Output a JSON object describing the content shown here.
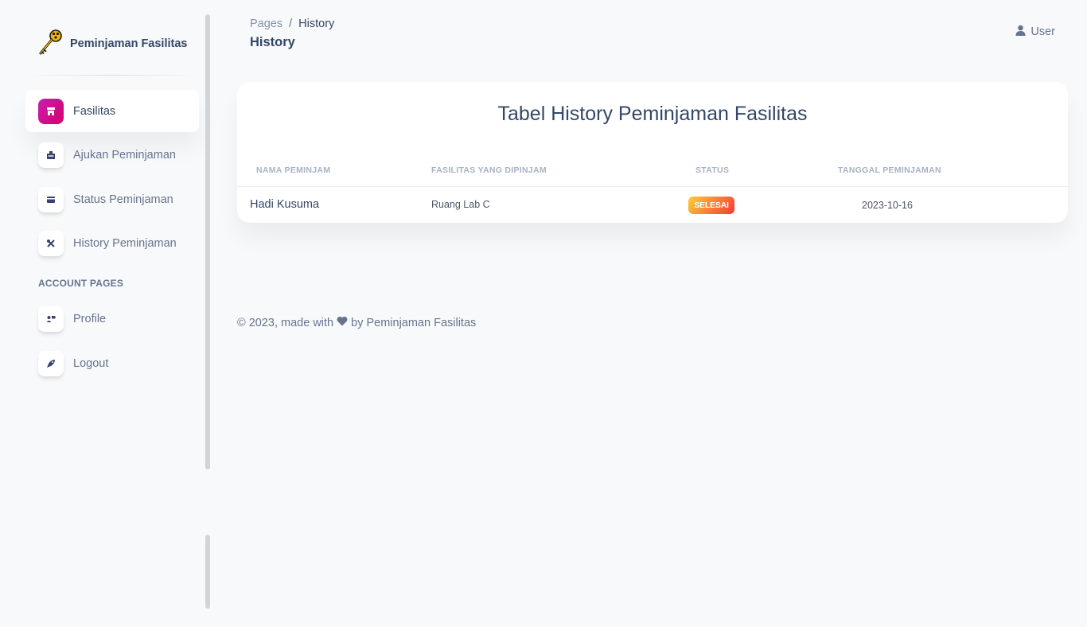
{
  "brand": {
    "name": "Peminjaman Fasilitas",
    "icon": "key-icon"
  },
  "sidebar": {
    "items": [
      {
        "label": "Fasilitas",
        "icon": "shop-icon",
        "active": true
      },
      {
        "label": "Ajukan Peminjaman",
        "icon": "office-building-icon",
        "active": false
      },
      {
        "label": "Status Peminjaman",
        "icon": "credit-card-icon",
        "active": false
      },
      {
        "label": "History Peminjaman",
        "icon": "settings-tools-icon",
        "active": false
      }
    ],
    "section_title": "ACCOUNT PAGES",
    "account_items": [
      {
        "label": "Profile",
        "icon": "user-card-icon"
      },
      {
        "label": "Logout",
        "icon": "rocket-icon"
      }
    ]
  },
  "header": {
    "breadcrumb_root": "Pages",
    "breadcrumb_sep": "/",
    "breadcrumb_current": "History",
    "title": "History",
    "user_label": "User"
  },
  "table": {
    "title": "Tabel History Peminjaman Fasilitas",
    "columns": [
      "NAMA PEMINJAM",
      "FASILITAS YANG DIPINJAM",
      "STATUS",
      "TANGGAL PEMINJAMAN"
    ],
    "rows": [
      {
        "nama": "Hadi Kusuma",
        "fasilitas": "Ruang Lab C",
        "status": "SELESAI",
        "tanggal": "2023-10-16"
      }
    ]
  },
  "footer": {
    "prefix": "© 2023, made with",
    "suffix": "by Peminjaman Fasilitas"
  },
  "colors": {
    "accent": "#d6006c",
    "badge_start": "#fbcf33",
    "badge_end": "#f53939",
    "text_dark": "#344767",
    "text_muted": "#67748e"
  }
}
